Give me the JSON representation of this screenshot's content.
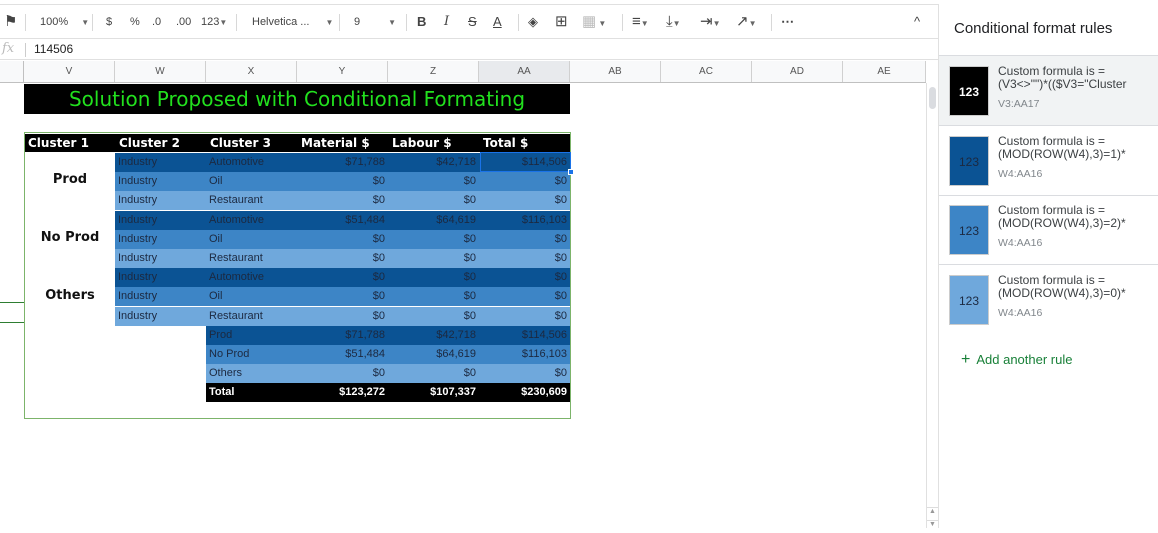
{
  "toolbar": {
    "paint_format_icon": "paint-format-icon",
    "zoom": "100%",
    "currency": "$",
    "percent": "%",
    "decrease_decimal": ".0",
    "increase_decimal": ".00",
    "more_formats": "123",
    "font": "Helvetica ...",
    "font_size": "9",
    "bold": "B",
    "italic": "I",
    "strikethrough": "S",
    "text_color": "A",
    "more": "⋯",
    "collapse": "^"
  },
  "formula_bar": {
    "fx": "fx",
    "value": "114506"
  },
  "columns": [
    "V",
    "W",
    "X",
    "Y",
    "Z",
    "AA",
    "AB",
    "AC",
    "AD",
    "AE"
  ],
  "selected_column": "AA",
  "sheet": {
    "title": "Solution Proposed with Conditional Formating",
    "headers": [
      "Cluster 1",
      "Cluster 2",
      "Cluster 3",
      "Material $",
      "Labour $",
      "Total $"
    ],
    "groups": [
      "Prod",
      "No Prod",
      "Others"
    ],
    "rows": [
      {
        "c2": "Industry",
        "c3": "Automotive",
        "material": "$71,788",
        "labour": "$42,718",
        "total": "$114,506"
      },
      {
        "c2": "Industry",
        "c3": "Oil",
        "material": "$0",
        "labour": "$0",
        "total": "$0"
      },
      {
        "c2": "Industry",
        "c3": "Restaurant",
        "material": "$0",
        "labour": "$0",
        "total": "$0"
      },
      {
        "c2": "Industry",
        "c3": "Automotive",
        "material": "$51,484",
        "labour": "$64,619",
        "total": "$116,103"
      },
      {
        "c2": "Industry",
        "c3": "Oil",
        "material": "$0",
        "labour": "$0",
        "total": "$0"
      },
      {
        "c2": "Industry",
        "c3": "Restaurant",
        "material": "$0",
        "labour": "$0",
        "total": "$0"
      },
      {
        "c2": "Industry",
        "c3": "Automotive",
        "material": "$0",
        "labour": "$0",
        "total": "$0"
      },
      {
        "c2": "Industry",
        "c3": "Oil",
        "material": "$0",
        "labour": "$0",
        "total": "$0"
      },
      {
        "c2": "Industry",
        "c3": "Restaurant",
        "material": "$0",
        "labour": "$0",
        "total": "$0"
      }
    ],
    "summary": [
      {
        "label": "Prod",
        "material": "$71,788",
        "labour": "$42,718",
        "total": "$114,506"
      },
      {
        "label": "No Prod",
        "material": "$51,484",
        "labour": "$64,619",
        "total": "$116,103"
      },
      {
        "label": "Others",
        "material": "$0",
        "labour": "$0",
        "total": "$0"
      }
    ],
    "total": {
      "label": "Total",
      "material": "$123,272",
      "labour": "$107,337",
      "total": "$230,609"
    }
  },
  "colors": {
    "title_text": "#22e01e",
    "band_dark": "#0b5394",
    "band_mid": "#3d85c6",
    "band_light": "#6fa8dc",
    "accent_green": "#188038"
  },
  "panel": {
    "title": "Conditional format rules",
    "rules": [
      {
        "swatch": "123",
        "line1": "Custom formula is =",
        "line2": "(V3<>\"\")*(($V3=\"Cluster",
        "range": "V3:AA17"
      },
      {
        "swatch": "123",
        "line1": "Custom formula is =",
        "line2": "(MOD(ROW(W4),3)=1)*",
        "range": "W4:AA16"
      },
      {
        "swatch": "123",
        "line1": "Custom formula is =",
        "line2": "(MOD(ROW(W4),3)=2)*",
        "range": "W4:AA16"
      },
      {
        "swatch": "123",
        "line1": "Custom formula is =",
        "line2": "(MOD(ROW(W4),3)=0)*",
        "range": "W4:AA16"
      }
    ],
    "add_rule": "Add another rule"
  }
}
